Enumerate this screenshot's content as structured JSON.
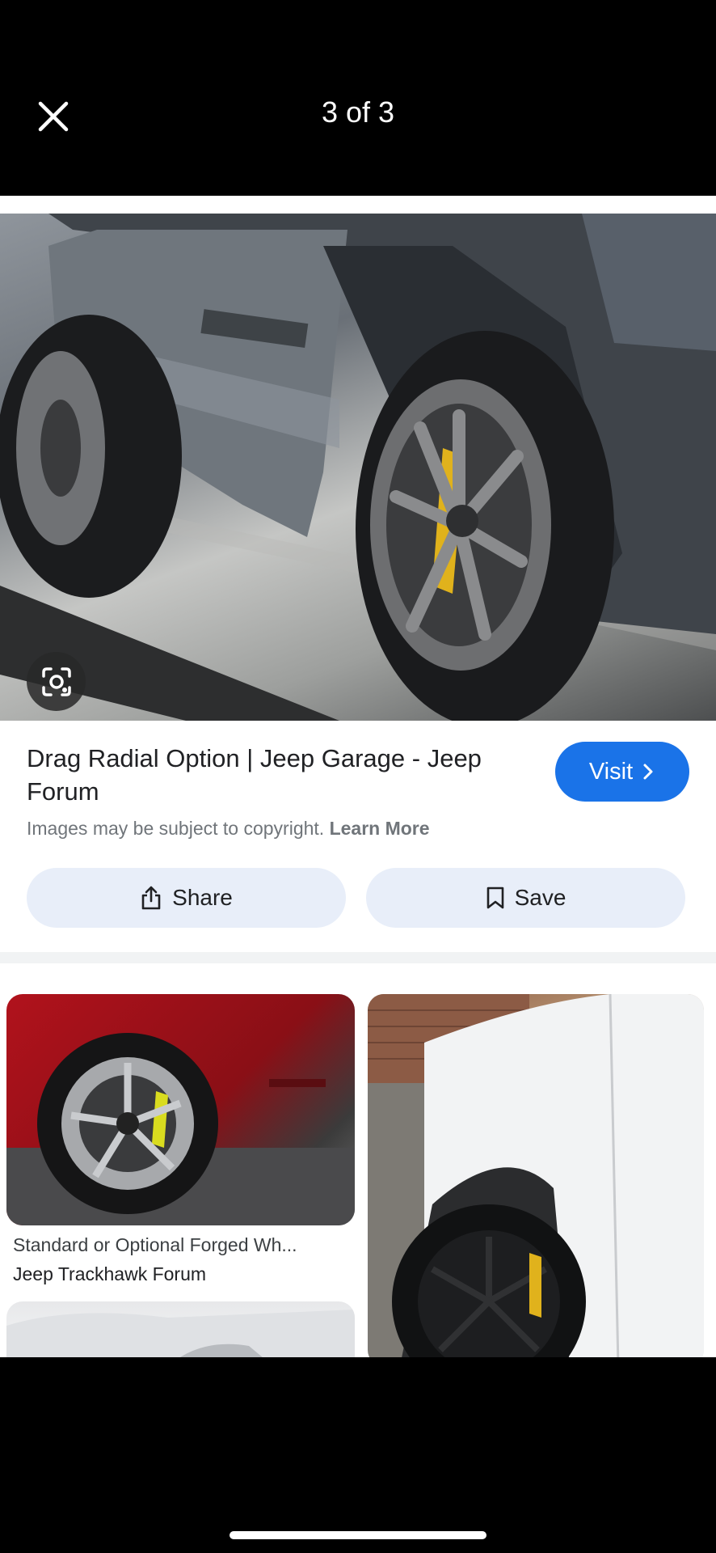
{
  "header": {
    "counter": "3 of 3"
  },
  "result": {
    "title": "Drag Radial Option | Jeep Garage - Jeep Forum",
    "visit_label": "Visit",
    "copyright_text": "Images may be subject to copyright.",
    "learn_more": "Learn More",
    "share_label": "Share",
    "save_label": "Save"
  },
  "related": [
    {
      "title": "Standard or Optional Forged Wh...",
      "source": "Jeep Trackhawk Forum"
    }
  ],
  "icons": {
    "close": "close-icon",
    "lens": "lens-icon",
    "chevron": "chevron-right-icon",
    "share": "share-icon",
    "bookmark": "bookmark-icon"
  },
  "colors": {
    "accent": "#1a73e8",
    "action_bg": "#e8eef9",
    "background": "#000000"
  }
}
